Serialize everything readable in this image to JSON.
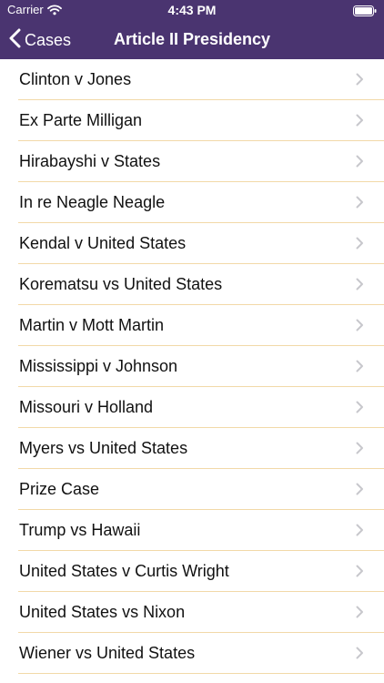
{
  "status_bar": {
    "carrier": "Carrier",
    "time": "4:43 PM"
  },
  "nav": {
    "back_label": "Cases",
    "title": "Article II Presidency"
  },
  "cases": [
    {
      "label": "Clinton v Jones"
    },
    {
      "label": "Ex Parte Milligan"
    },
    {
      "label": "Hirabayshi v States"
    },
    {
      "label": "In re Neagle Neagle"
    },
    {
      "label": "Kendal v United States"
    },
    {
      "label": "Korematsu vs United States"
    },
    {
      "label": "Martin v Mott Martin"
    },
    {
      "label": "Mississippi v Johnson"
    },
    {
      "label": "Missouri v Holland"
    },
    {
      "label": "Myers vs United States"
    },
    {
      "label": "Prize Case"
    },
    {
      "label": "Trump vs Hawaii"
    },
    {
      "label": "United States v Curtis Wright"
    },
    {
      "label": "United States vs Nixon"
    },
    {
      "label": "Wiener vs United States"
    }
  ],
  "colors": {
    "nav_background": "#4a3470",
    "separator": "#f2d9a8",
    "chevron": "#c7c7cc"
  }
}
